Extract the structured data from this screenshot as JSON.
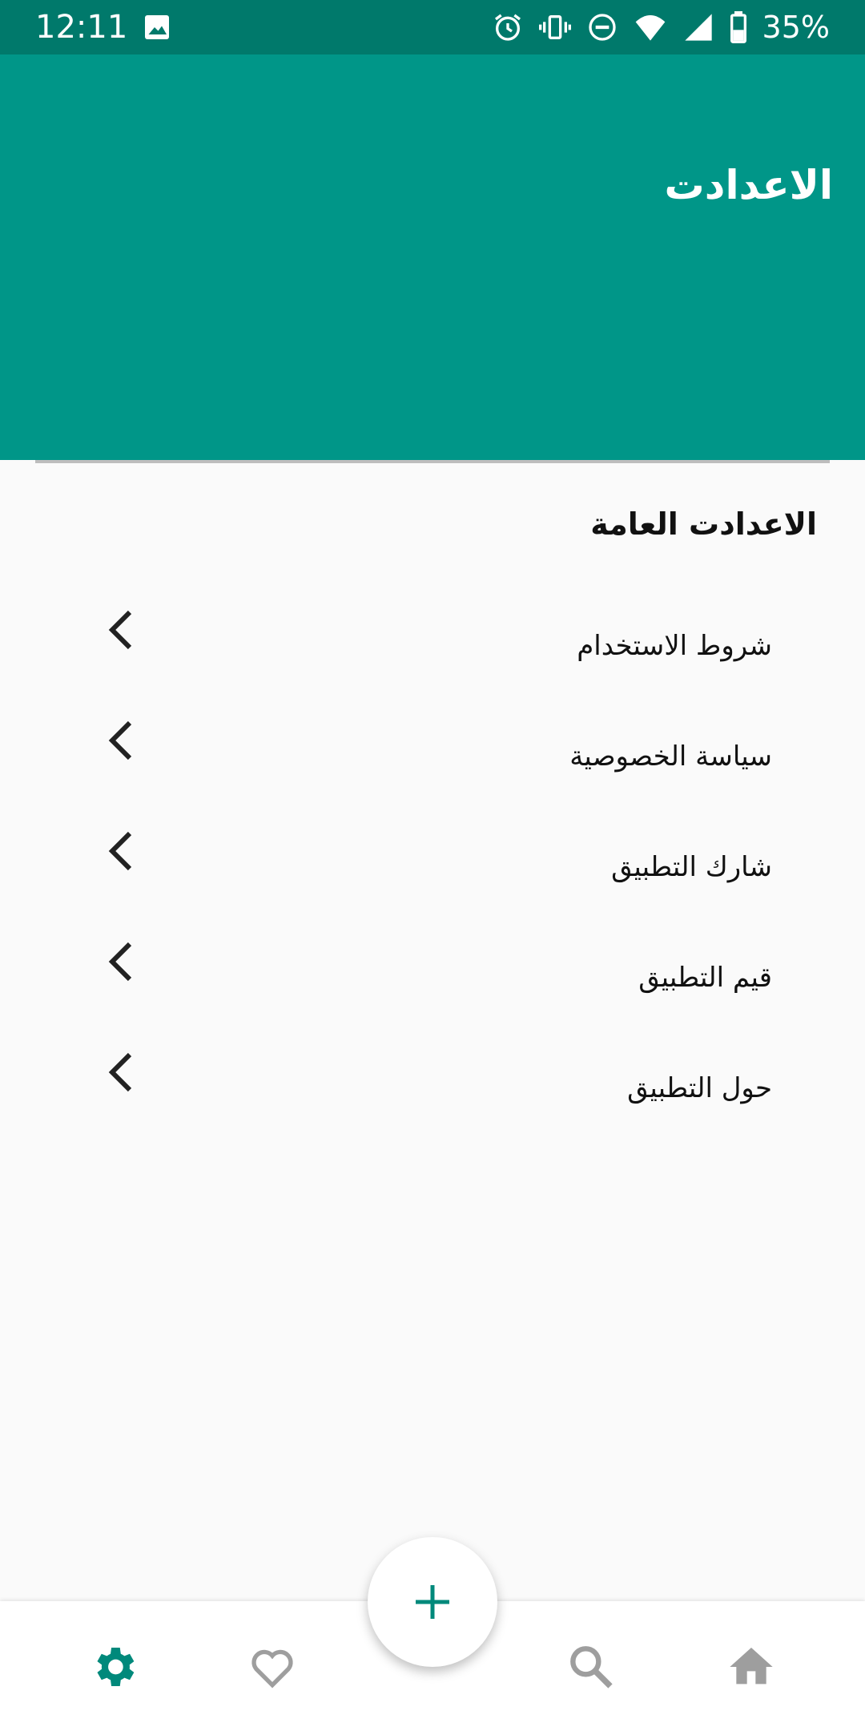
{
  "status_bar": {
    "time": "12:11",
    "battery_percent": "35%",
    "icons": [
      "gallery-icon",
      "alarm-icon",
      "vibrate-icon",
      "dnd-icon",
      "wifi-icon",
      "signal-icon",
      "battery-icon"
    ]
  },
  "app_bar": {
    "title": "الاعدادت",
    "color": "#009688"
  },
  "settings": {
    "section_title": "الاعدادت العامة",
    "items": [
      {
        "label": "شروط الاستخدام",
        "icon": "chevron-left-icon"
      },
      {
        "label": "سياسة الخصوصية",
        "icon": "chevron-left-icon"
      },
      {
        "label": "شارك التطبيق",
        "icon": "chevron-left-icon"
      },
      {
        "label": "قيم التطبيق",
        "icon": "chevron-left-icon"
      },
      {
        "label": "حول التطبيق",
        "icon": "chevron-left-icon"
      }
    ]
  },
  "bottom_nav": {
    "active": "settings",
    "accent_color": "#00897b",
    "items": [
      "settings-icon",
      "heart-icon",
      "search-icon",
      "home-icon"
    ],
    "fab_icon": "plus-icon"
  }
}
